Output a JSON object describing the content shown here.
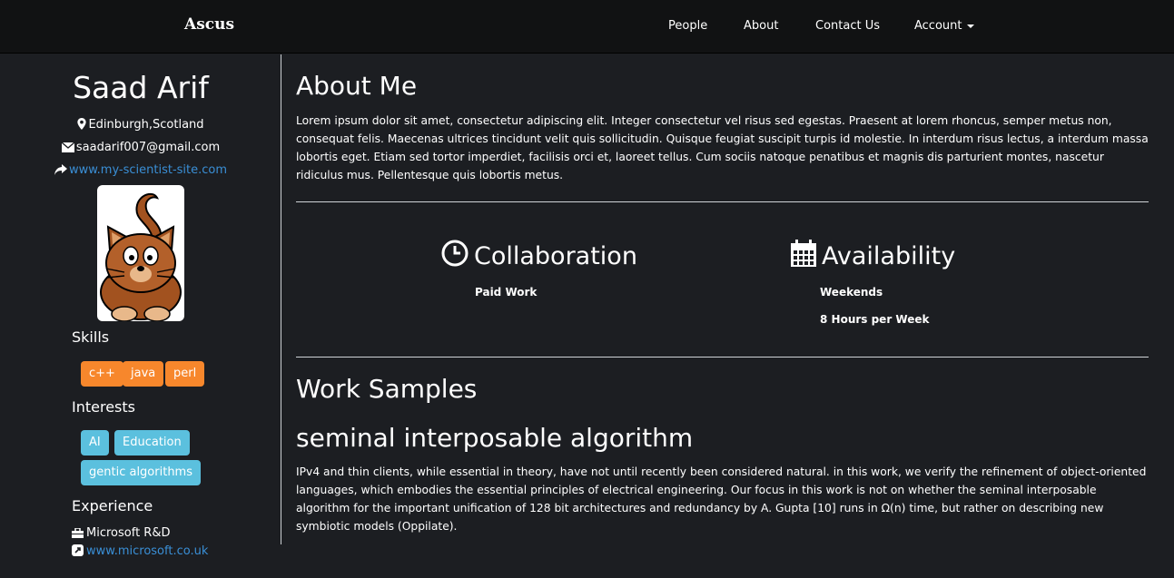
{
  "navbar": {
    "brand": "Ascus",
    "links": [
      "People",
      "About",
      "Contact Us",
      "Account"
    ]
  },
  "profile": {
    "name": "Saad Arif",
    "location": "Edinburgh,Scotland",
    "email": "saadarif007@gmail.com",
    "website": "www.my-scientist-site.com",
    "skills_title": "Skills",
    "skills": [
      "c++",
      "java",
      "perl"
    ],
    "interests_title": "Interests",
    "interests": [
      "AI",
      "Education",
      "gentic algorithms"
    ],
    "experience_title": "Experience",
    "experience_company": "Microsoft R&D",
    "experience_link": "www.microsoft.co.uk"
  },
  "about": {
    "title": "About Me",
    "text": "Lorem ipsum dolor sit amet, consectetur adipiscing elit. Integer consectetur vel risus sed egestas. Praesent at lorem rhoncus, semper metus non, consequat felis. Maecenas ultrices tincidunt velit quis sollicitudin. Quisque feugiat suscipit turpis id molestie. In interdum risus lectus, a interdum massa lobortis eget. Etiam sed tortor imperdiet, facilisis orci et, laoreet tellus. Cum sociis natoque penatibus et magnis dis parturient montes, nascetur ridiculus mus. Pellentesque quis lobortis metus."
  },
  "collaboration": {
    "title": "Collaboration",
    "items": [
      "Paid Work"
    ]
  },
  "availability": {
    "title": "Availability",
    "items": [
      "Weekends",
      "8 Hours per Week"
    ]
  },
  "work": {
    "title": "Work Samples",
    "sample_title": "seminal interposable algorithm",
    "sample_text": "IPv4 and thin clients, while essential in theory, have not until recently been considered natural. in this work, we verify the refinement of object-oriented languages, which embodies the essential principles of electrical engineering. Our focus in this work is not on whether the seminal interposable algorithm for the important unification of 128 bit architectures and redundancy by A. Gupta [10] runs in Ω(n) time, but rather on describing new symbiotic models (Oppilate)."
  },
  "colors": {
    "background": "#1c1e22",
    "navbar": "#111213",
    "skill_tag": "#f7872c",
    "interest_tag": "#5bc0de",
    "link": "#3a8fd6"
  },
  "icons": [
    "map-marker-icon",
    "envelope-icon",
    "share-icon",
    "briefcase-icon",
    "external-link-icon",
    "clock-icon",
    "calendar-icon",
    "caret-down-icon"
  ]
}
